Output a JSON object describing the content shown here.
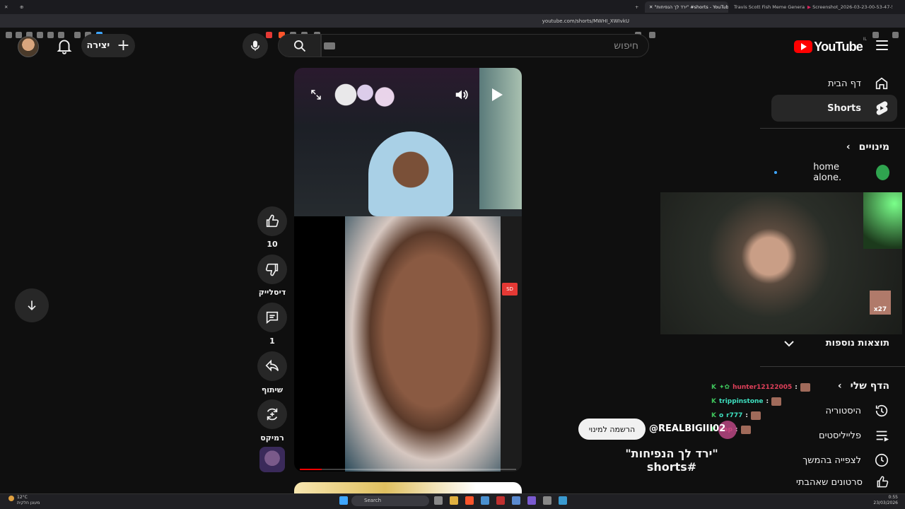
{
  "browser": {
    "tabs": [
      {
        "title": "\"ירד לך הנפיחות\" #shorts - YouTube",
        "active": true
      },
      {
        "title": "Travis Scott Fish Meme Generator - I",
        "active": false
      },
      {
        "title": "Screenshot_2026-03-23-00-53-47-5",
        "active": false
      }
    ],
    "url": "youtube.com/shorts/MWHI_XWIvkU"
  },
  "header": {
    "logo_text": "YouTube",
    "country_code": "IL",
    "search_placeholder": "חיפוש",
    "create_label": "יצירה"
  },
  "sidebar": {
    "items": [
      {
        "label": "דף הבית",
        "icon": "home-icon",
        "active": false
      },
      {
        "label": "Shorts",
        "icon": "shorts-icon",
        "active": true
      }
    ],
    "subscriptions_heading": "מינויים",
    "subscriptions": [
      {
        "name": "home alone.",
        "color": "#2fa44f"
      }
    ],
    "more_results": "תוצאות נוספות",
    "you_heading": "הדף שלי",
    "you_items": [
      {
        "label": "היסטוריה",
        "icon": "history-icon"
      },
      {
        "label": "פלייליסטים",
        "icon": "playlist-icon"
      },
      {
        "label": "לצפייה בהמשך",
        "icon": "clock-icon"
      },
      {
        "label": "סרטונים שאהבתי",
        "icon": "like-icon"
      }
    ]
  },
  "actions": {
    "like_count": "10",
    "dislike_label": "דיסלייק",
    "comment_count": "1",
    "share_label": "שיתוף",
    "remix_label": "רמיקס"
  },
  "video": {
    "title": "\"ירד לך הנפיחות\" #shorts",
    "channel": "@REALBIGIII02",
    "subscribe_label": "הרשמה למינוי",
    "progress": 0.1,
    "webcam_badge": "x27",
    "rec_label": "SD"
  },
  "chat": [
    {
      "user": "hunter12122005",
      "color": "#e0405a"
    },
    {
      "user": "trippinstone",
      "color": "#3ee0c0"
    },
    {
      "user": "r777",
      "color": "#3ee0c0"
    },
    {
      "user": "nap",
      "color": "#e0405a"
    }
  ],
  "taskbar": {
    "search_label": "Search",
    "weather_temp": "12°C",
    "weather_desc": "מעונן חלקית",
    "time": "0:55",
    "date": "23/03/2026"
  }
}
